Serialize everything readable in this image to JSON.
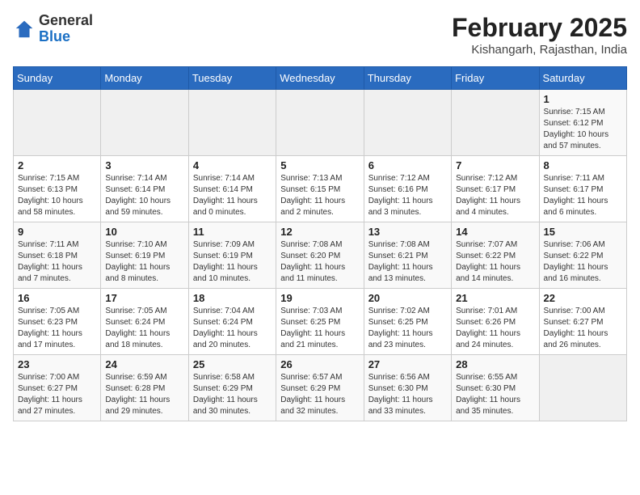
{
  "header": {
    "logo_line1": "General",
    "logo_line2": "Blue",
    "month_title": "February 2025",
    "location": "Kishangarh, Rajasthan, India"
  },
  "weekdays": [
    "Sunday",
    "Monday",
    "Tuesday",
    "Wednesday",
    "Thursday",
    "Friday",
    "Saturday"
  ],
  "weeks": [
    [
      {
        "day": "",
        "info": ""
      },
      {
        "day": "",
        "info": ""
      },
      {
        "day": "",
        "info": ""
      },
      {
        "day": "",
        "info": ""
      },
      {
        "day": "",
        "info": ""
      },
      {
        "day": "",
        "info": ""
      },
      {
        "day": "1",
        "info": "Sunrise: 7:15 AM\nSunset: 6:12 PM\nDaylight: 10 hours\nand 57 minutes."
      }
    ],
    [
      {
        "day": "2",
        "info": "Sunrise: 7:15 AM\nSunset: 6:13 PM\nDaylight: 10 hours\nand 58 minutes."
      },
      {
        "day": "3",
        "info": "Sunrise: 7:14 AM\nSunset: 6:14 PM\nDaylight: 10 hours\nand 59 minutes."
      },
      {
        "day": "4",
        "info": "Sunrise: 7:14 AM\nSunset: 6:14 PM\nDaylight: 11 hours\nand 0 minutes."
      },
      {
        "day": "5",
        "info": "Sunrise: 7:13 AM\nSunset: 6:15 PM\nDaylight: 11 hours\nand 2 minutes."
      },
      {
        "day": "6",
        "info": "Sunrise: 7:12 AM\nSunset: 6:16 PM\nDaylight: 11 hours\nand 3 minutes."
      },
      {
        "day": "7",
        "info": "Sunrise: 7:12 AM\nSunset: 6:17 PM\nDaylight: 11 hours\nand 4 minutes."
      },
      {
        "day": "8",
        "info": "Sunrise: 7:11 AM\nSunset: 6:17 PM\nDaylight: 11 hours\nand 6 minutes."
      }
    ],
    [
      {
        "day": "9",
        "info": "Sunrise: 7:11 AM\nSunset: 6:18 PM\nDaylight: 11 hours\nand 7 minutes."
      },
      {
        "day": "10",
        "info": "Sunrise: 7:10 AM\nSunset: 6:19 PM\nDaylight: 11 hours\nand 8 minutes."
      },
      {
        "day": "11",
        "info": "Sunrise: 7:09 AM\nSunset: 6:19 PM\nDaylight: 11 hours\nand 10 minutes."
      },
      {
        "day": "12",
        "info": "Sunrise: 7:08 AM\nSunset: 6:20 PM\nDaylight: 11 hours\nand 11 minutes."
      },
      {
        "day": "13",
        "info": "Sunrise: 7:08 AM\nSunset: 6:21 PM\nDaylight: 11 hours\nand 13 minutes."
      },
      {
        "day": "14",
        "info": "Sunrise: 7:07 AM\nSunset: 6:22 PM\nDaylight: 11 hours\nand 14 minutes."
      },
      {
        "day": "15",
        "info": "Sunrise: 7:06 AM\nSunset: 6:22 PM\nDaylight: 11 hours\nand 16 minutes."
      }
    ],
    [
      {
        "day": "16",
        "info": "Sunrise: 7:05 AM\nSunset: 6:23 PM\nDaylight: 11 hours\nand 17 minutes."
      },
      {
        "day": "17",
        "info": "Sunrise: 7:05 AM\nSunset: 6:24 PM\nDaylight: 11 hours\nand 18 minutes."
      },
      {
        "day": "18",
        "info": "Sunrise: 7:04 AM\nSunset: 6:24 PM\nDaylight: 11 hours\nand 20 minutes."
      },
      {
        "day": "19",
        "info": "Sunrise: 7:03 AM\nSunset: 6:25 PM\nDaylight: 11 hours\nand 21 minutes."
      },
      {
        "day": "20",
        "info": "Sunrise: 7:02 AM\nSunset: 6:25 PM\nDaylight: 11 hours\nand 23 minutes."
      },
      {
        "day": "21",
        "info": "Sunrise: 7:01 AM\nSunset: 6:26 PM\nDaylight: 11 hours\nand 24 minutes."
      },
      {
        "day": "22",
        "info": "Sunrise: 7:00 AM\nSunset: 6:27 PM\nDaylight: 11 hours\nand 26 minutes."
      }
    ],
    [
      {
        "day": "23",
        "info": "Sunrise: 7:00 AM\nSunset: 6:27 PM\nDaylight: 11 hours\nand 27 minutes."
      },
      {
        "day": "24",
        "info": "Sunrise: 6:59 AM\nSunset: 6:28 PM\nDaylight: 11 hours\nand 29 minutes."
      },
      {
        "day": "25",
        "info": "Sunrise: 6:58 AM\nSunset: 6:29 PM\nDaylight: 11 hours\nand 30 minutes."
      },
      {
        "day": "26",
        "info": "Sunrise: 6:57 AM\nSunset: 6:29 PM\nDaylight: 11 hours\nand 32 minutes."
      },
      {
        "day": "27",
        "info": "Sunrise: 6:56 AM\nSunset: 6:30 PM\nDaylight: 11 hours\nand 33 minutes."
      },
      {
        "day": "28",
        "info": "Sunrise: 6:55 AM\nSunset: 6:30 PM\nDaylight: 11 hours\nand 35 minutes."
      },
      {
        "day": "",
        "info": ""
      }
    ]
  ]
}
